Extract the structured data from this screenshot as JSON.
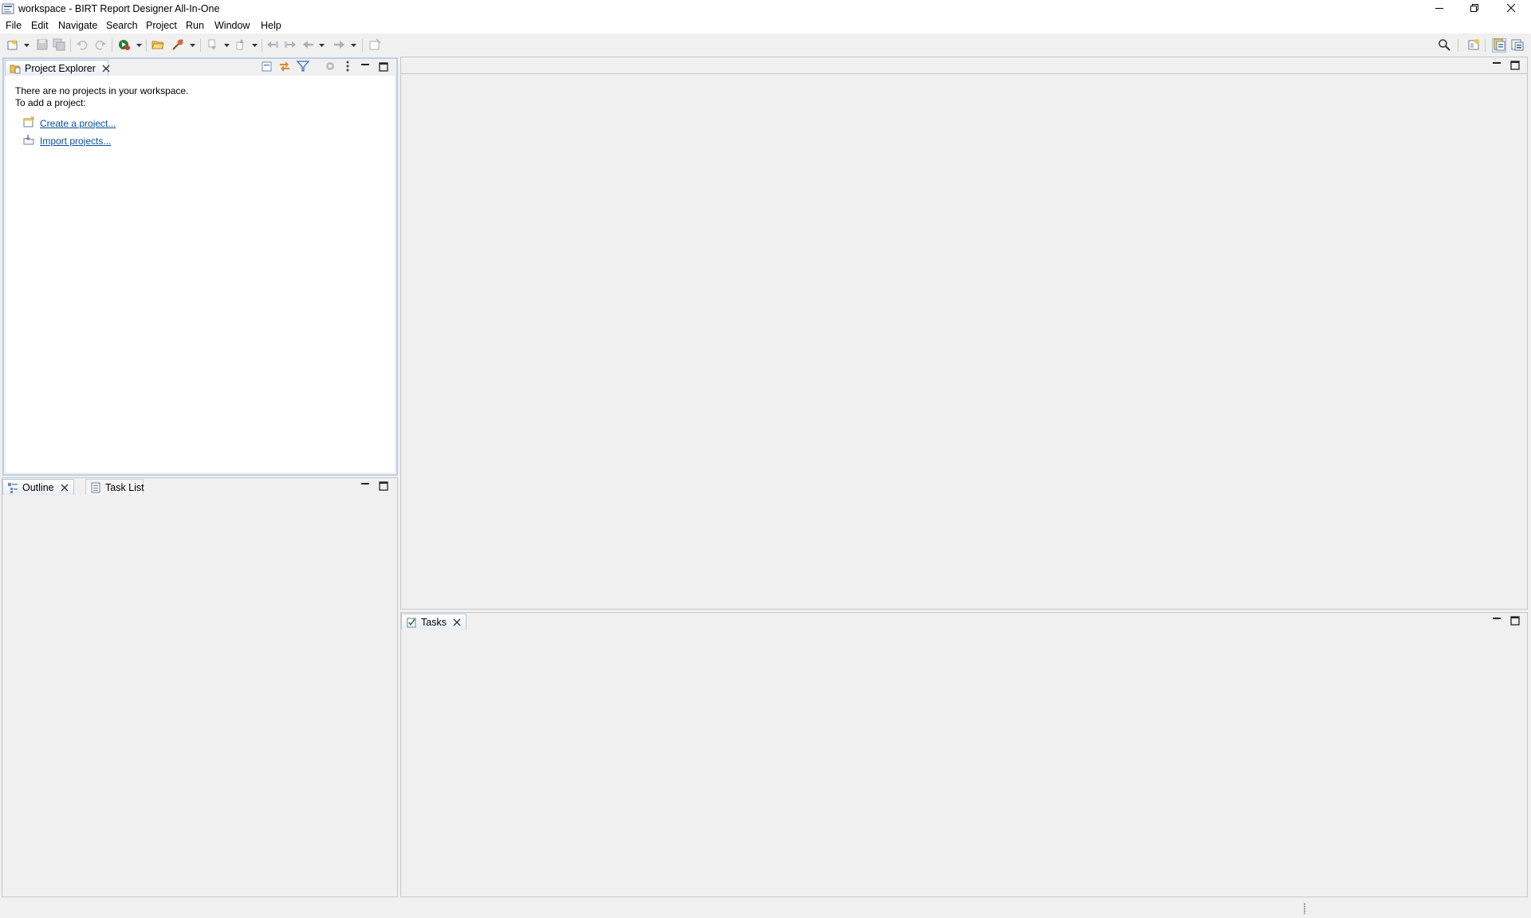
{
  "window": {
    "title": "workspace - BIRT Report Designer All-In-One",
    "icon": "birt-app-icon",
    "controls": [
      "minimize-icon",
      "restore-icon",
      "close-icon"
    ]
  },
  "menu": {
    "items": [
      "File",
      "Edit",
      "Navigate",
      "Search",
      "Project",
      "Run",
      "Window",
      "Help"
    ]
  },
  "toolbar": {
    "left_icons": [
      "new-wizard-icon",
      "save-icon",
      "save-all-icon",
      "undo-icon",
      "redo-icon",
      "run-icon",
      "open-file-icon",
      "external-tools-icon",
      "next-annotation-icon",
      "previous-annotation-icon",
      "last-edit-location-icon",
      "back-icon",
      "forward-icon",
      "pin-editor-icon"
    ],
    "right_icons": [
      "search-icon",
      "open-perspective-icon",
      "report-design-perspective-icon",
      "resource-perspective-icon"
    ]
  },
  "project_explorer": {
    "tab_label": "Project Explorer",
    "empty_line1": "There are no projects in your workspace.",
    "empty_line2": "To add a project:",
    "create_link": "Create a project...",
    "import_link": "Import projects...",
    "toolbar_icons": [
      "collapse-all-icon",
      "link-with-editor-icon",
      "filter-icon",
      "focus-icon",
      "view-menu-icon"
    ]
  },
  "outline": {
    "tab_label": "Outline",
    "task_list_label": "Task List"
  },
  "tasks": {
    "tab_label": "Tasks"
  },
  "colors": {
    "link": "#0a4d9e",
    "active_border": "#bdcfe6",
    "background": "#f0f0f0"
  }
}
